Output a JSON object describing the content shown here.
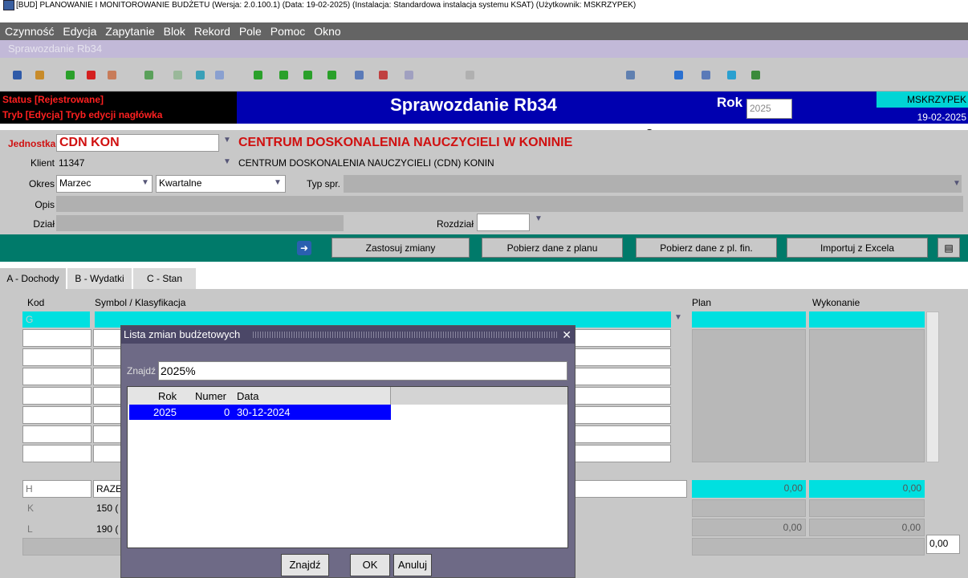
{
  "window_title": "[BUD] PLANOWANIE I MONITOROWANIE BUDŻETU (Wersja: 2.0.100.1) (Data: 19-02-2025) (Instalacja: Standardowa instalacja systemu KSAT) (Użytkownik: MSKRZYPEK)",
  "menu": [
    "Czynność",
    "Edycja",
    "Zapytanie",
    "Blok",
    "Rekord",
    "Pole",
    "Pomoc",
    "Okno"
  ],
  "subwindow_title": "Sprawozdanie Rb34",
  "toolbar": {
    "right_label": "O..."
  },
  "header": {
    "status": "Status [Rejestrowane]",
    "mode": "Tryb [Edycja]  Tryb edycji nagłówka",
    "title": "Sprawozdanie Rb34",
    "rok_label": "Rok",
    "rok_value": "2025",
    "user": "MSKRZYPEK",
    "date": "19-02-2025"
  },
  "form": {
    "jednostka_label": "Jednostka",
    "jednostka_value": "CDN KON",
    "jednostka_name": "CENTRUM DOSKONALENIA NAUCZYCIELI W KONINIE",
    "klient_label": "Klient",
    "klient_value": "11347",
    "klient_name": "CENTRUM DOSKONALENIA NAUCZYCIELI (CDN) KONIN",
    "okres_label": "Okres",
    "okres_value": "Marzec",
    "okres_type": "Kwartalne",
    "typ_label": "Typ spr.",
    "opis_label": "Opis",
    "dzial_label": "Dział",
    "rozdzial_label": "Rozdział"
  },
  "actions": [
    "Zastosuj zmiany",
    "Pobierz dane z planu",
    "Pobierz dane z pl. fin.",
    "Importuj z Excela"
  ],
  "tabs": [
    "A - Dochody",
    "B - Wydatki",
    "C - Stan"
  ],
  "grid": {
    "headers": {
      "kod": "Kod",
      "symbol": "Symbol / Klasyfikacja",
      "plan": "Plan",
      "wykonanie": "Wykonanie"
    },
    "first_kod": "G",
    "rows": [
      {
        "kod": "H",
        "symbol": "RAZEM",
        "plan": "0,00",
        "wykonanie": "0,00"
      },
      {
        "kod": "K",
        "symbol": "150 (",
        "plan": "",
        "wykonanie": ""
      },
      {
        "kod": "L",
        "symbol": "190 (",
        "plan": "0,00",
        "wykonanie": "0,00"
      }
    ],
    "bottom_total": "0,00"
  },
  "dialog": {
    "title": "Lista zmian budżetowych",
    "find_label": "Znajdź",
    "find_value": "2025%",
    "columns": [
      "Rok",
      "Numer",
      "Data"
    ],
    "rows": [
      {
        "rok": "2025",
        "numer": "0",
        "data": "30-12-2024"
      }
    ],
    "buttons": {
      "find": "Znajdź",
      "ok": "OK",
      "cancel": "Anuluj"
    }
  }
}
